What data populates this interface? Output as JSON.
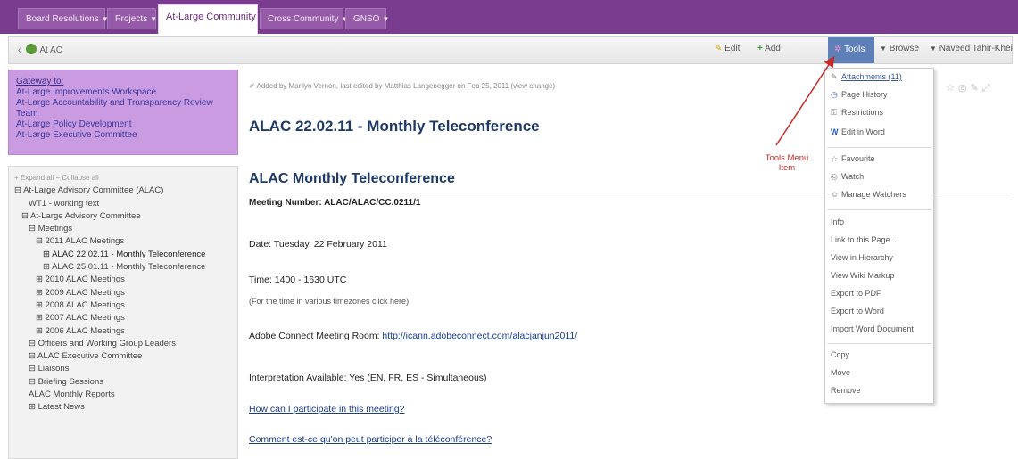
{
  "topbar": {
    "tabs": [
      {
        "label": "Board Resolutions",
        "caret": "▼"
      },
      {
        "label": "Projects",
        "caret": "▼"
      },
      {
        "label": "At-Large Community",
        "caret": "▼"
      },
      {
        "label": "Cross Community",
        "caret": "▼"
      },
      {
        "label": "GNSO",
        "caret": "▼"
      }
    ]
  },
  "crumbbar": {
    "back": "‹",
    "breadcrumb": "At AC",
    "edit": "Edit",
    "add": "Add",
    "tools": "Tools",
    "browse": "Browse",
    "user": "Naveed Tahir-Khei"
  },
  "gateway": {
    "title": "Gateway to:",
    "links": [
      "At-Large Improvements Workspace",
      "At-Large Accountability and Transparency Review Team",
      "At-Large Policy Development",
      "At-Large Executive Committee"
    ]
  },
  "tree": {
    "controls": "+ Expand all  − Collapse all",
    "items": [
      "⊟ At-Large Advisory Committee (ALAC)",
      "WT1 - working text",
      "⊟ At-Large Advisory Committee",
      "⊟ Meetings",
      "⊟ 2011 ALAC Meetings",
      "⊞ ALAC 22.02.11 - Monthly Teleconference",
      "⊞ ALAC 25.01.11 - Monthly Teleconference",
      "⊞ 2010 ALAC Meetings",
      "⊞ 2009 ALAC Meetings",
      "⊞ 2008 ALAC Meetings",
      "⊞ 2007 ALAC Meetings",
      "⊞ 2006 ALAC Meetings",
      "⊟ Officers and Working Group Leaders",
      "⊟ ALAC Executive Committee",
      "⊟ Liaisons",
      "⊟ Briefing Sessions",
      "ALAC Monthly Reports",
      "⊞ Latest News"
    ]
  },
  "main": {
    "meta": "Added by Marilyn Vernon, last edited by Matthias Langenegger on Feb 25, 2011 (view change)",
    "title": "ALAC 22.02.11 - Monthly Teleconference",
    "heading": "ALAC Monthly Teleconference",
    "meeting_number": "Meeting Number: ALAC/ALAC/CC.0211/1",
    "date": "Date: Tuesday, 22 February 2011",
    "time": "Time: 1400 - 1630 UTC",
    "time_note": "(For the time in various timezones click here)",
    "adobe_label": "Adobe Connect Meeting Room: ",
    "adobe_link": "http://icann.adobeconnect.com/alacjanjun2011/",
    "interpretation": "Interpretation Available: Yes (EN, FR, ES - Simultaneous)",
    "link_participate": "How can I participate in this meeting?",
    "link_participate_fr": "Comment est-ce qu'on peut participer à la téléconférence?"
  },
  "dropdown": {
    "items": [
      "Attachments (11)",
      "Page History",
      "Restrictions",
      "Edit in Word",
      "Favourite",
      "Watch",
      "Manage Watchers",
      "Info",
      "Link to this Page...",
      "View in Hierarchy",
      "View Wiki Markup",
      "Export to PDF",
      "Export to Word",
      "Import Word Document",
      "Copy",
      "Move",
      "Remove"
    ]
  },
  "annotation": "Tools Menu Item",
  "colors": {
    "topbar": "#7a3c8f",
    "tools": "#5f7fb8",
    "annotation": "#c82a2a",
    "gateway": "#ca9be0"
  }
}
